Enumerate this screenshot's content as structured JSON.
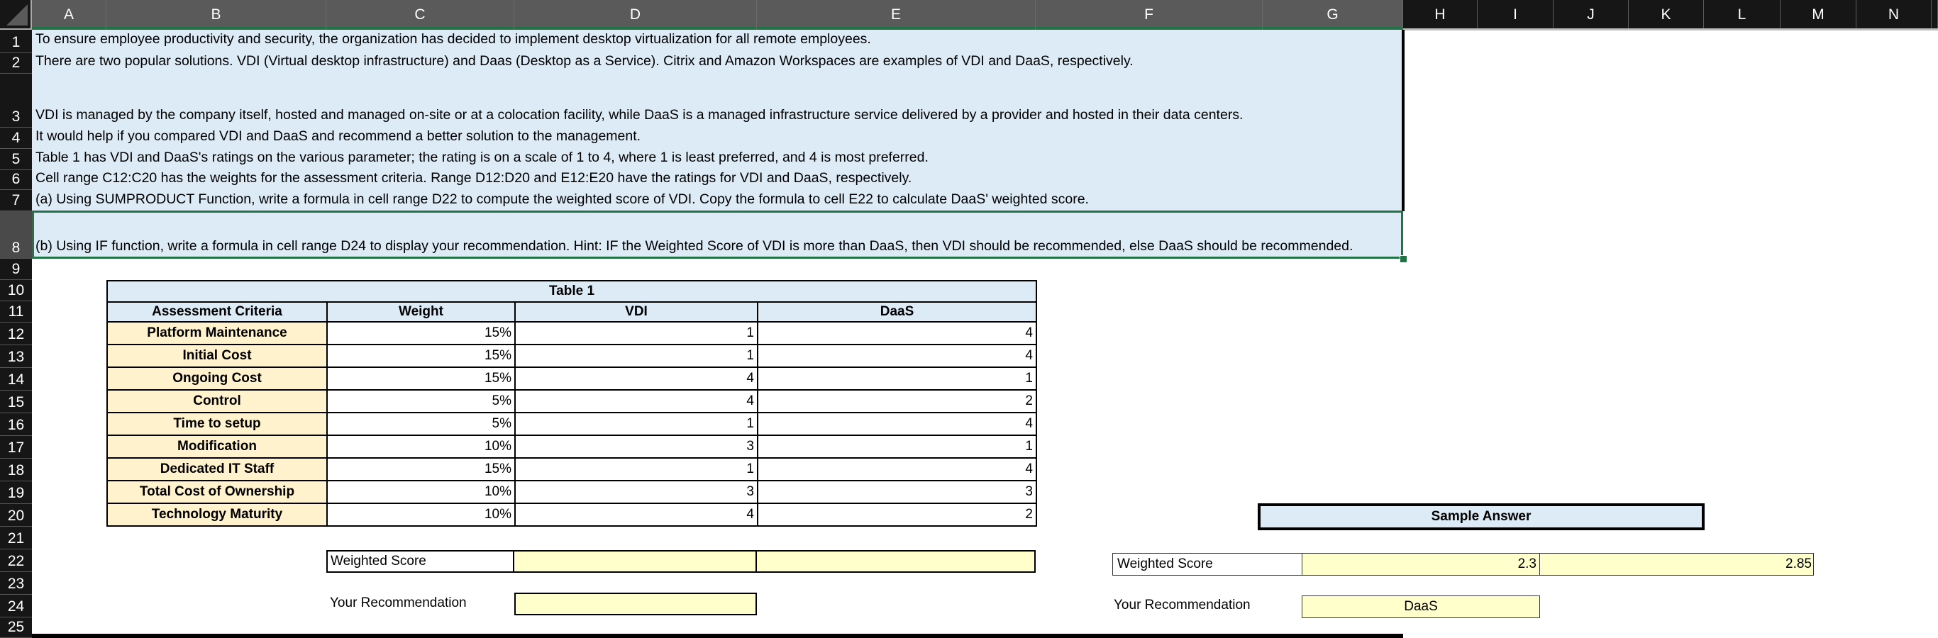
{
  "columns": [
    "A",
    "B",
    "C",
    "D",
    "E",
    "F",
    "G",
    "H",
    "I",
    "J",
    "K",
    "L",
    "M",
    "N"
  ],
  "selected_columns": [
    "A",
    "B",
    "C",
    "D",
    "E",
    "F",
    "G"
  ],
  "rows": [
    "1",
    "2",
    "3",
    "4",
    "5",
    "6",
    "7",
    "8",
    "9",
    "10",
    "11",
    "12",
    "13",
    "14",
    "15",
    "16",
    "17",
    "18",
    "19",
    "20",
    "21",
    "22",
    "23",
    "24",
    "25"
  ],
  "intro": [
    "To ensure employee productivity and security, the organization has decided to implement desktop virtualization for all remote employees.",
    "There are two popular solutions. VDI (Virtual desktop infrastructure) and Daas (Desktop as a Service). Citrix and Amazon Workspaces are examples of VDI and  DaaS, respectively.",
    "VDI is managed by the company itself, hosted and managed on-site or at a colocation facility, while DaaS is a managed infrastructure service delivered by a provider and hosted in their data centers.",
    "It would help if you compared VDI and DaaS and recommend a better solution to the management.",
    "Table 1 has VDI and DaaS's ratings on the various parameter; the rating is on a scale of 1 to 4, where 1 is least preferred, and 4 is most preferred.",
    "Cell range C12:C20 has the weights for the assessment criteria. Range D12:D20 and E12:E20 have the ratings for VDI and DaaS, respectively.",
    "(a) Using SUMPRODUCT Function, write a formula in cell range D22 to compute the weighted score of VDI. Copy the formula to cell E22 to calculate DaaS' weighted score.",
    "(b) Using IF function, write a formula in cell range D24 to display your recommendation. Hint: IF the Weighted Score of VDI is more than DaaS, then VDI should be recommended, else DaaS should be recommended."
  ],
  "table1": {
    "title": "Table 1",
    "headers": [
      "Assessment Criteria",
      "Weight",
      "VDI",
      "DaaS"
    ],
    "rows": [
      {
        "criteria": "Platform Maintenance",
        "weight": "15%",
        "vdi": "1",
        "daas": "4"
      },
      {
        "criteria": "Initial Cost",
        "weight": "15%",
        "vdi": "1",
        "daas": "4"
      },
      {
        "criteria": "Ongoing Cost",
        "weight": "15%",
        "vdi": "4",
        "daas": "1"
      },
      {
        "criteria": "Control",
        "weight": "5%",
        "vdi": "4",
        "daas": "2"
      },
      {
        "criteria": "Time to setup",
        "weight": "5%",
        "vdi": "1",
        "daas": "4"
      },
      {
        "criteria": "Modification",
        "weight": "10%",
        "vdi": "3",
        "daas": "1"
      },
      {
        "criteria": "Dedicated IT Staff",
        "weight": "15%",
        "vdi": "1",
        "daas": "4"
      },
      {
        "criteria": "Total Cost of Ownership",
        "weight": "10%",
        "vdi": "3",
        "daas": "3"
      },
      {
        "criteria": "Technology Maturity",
        "weight": "10%",
        "vdi": "4",
        "daas": "2"
      }
    ]
  },
  "answer_area": {
    "weighted_score_label": "Weighted Score",
    "vdi_score": "",
    "daas_score": "",
    "recommendation_label": "Your Recommendation",
    "recommendation": ""
  },
  "sample_answer": {
    "title": "Sample Answer",
    "weighted_score_label": "Weighted Score",
    "vdi_score": "2.3",
    "daas_score": "2.85",
    "recommendation_label": "Your Recommendation",
    "recommendation": "DaaS"
  }
}
